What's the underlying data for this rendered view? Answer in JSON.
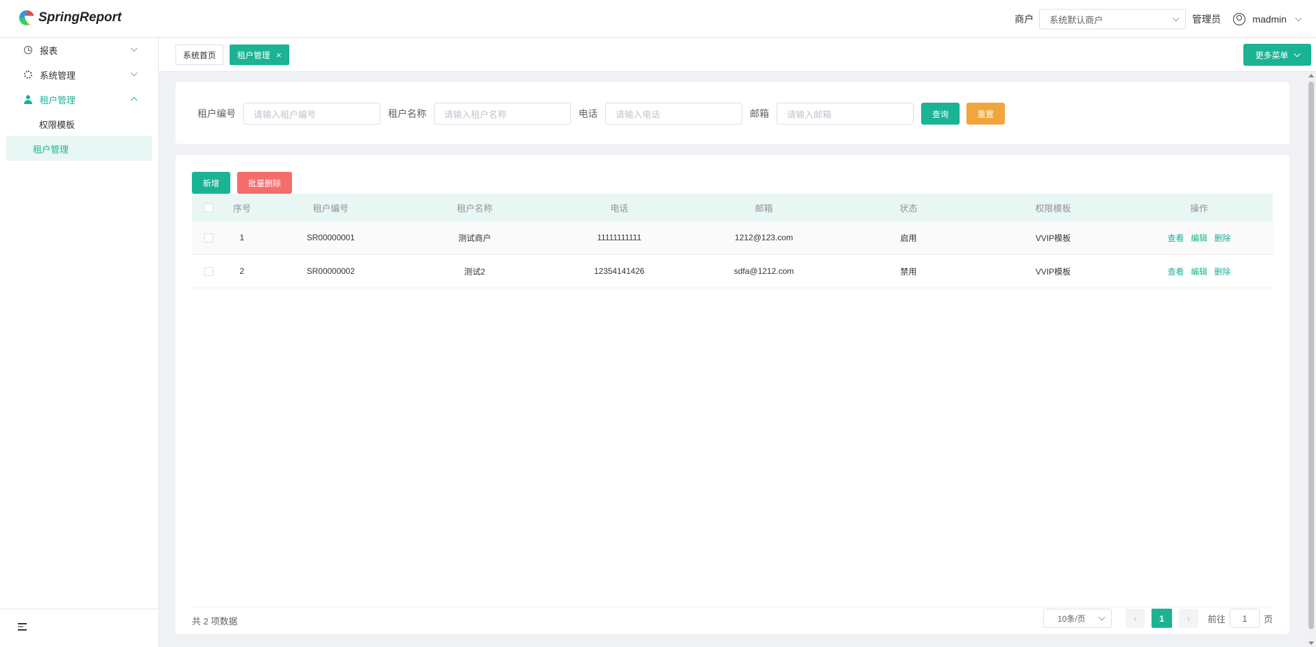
{
  "app": {
    "logo_text": "SpringReport"
  },
  "header": {
    "merchant_label": "商户",
    "merchant_value": "系统默认商户",
    "role_label": "管理员",
    "username": "madmin"
  },
  "sidebar": {
    "items": [
      {
        "label": "报表",
        "icon": "clock-icon"
      },
      {
        "label": "系统管理",
        "icon": "gear-icon"
      },
      {
        "label": "租户管理",
        "icon": "user-icon"
      }
    ],
    "subitems": [
      {
        "label": "权限模板"
      },
      {
        "label": "租户管理"
      }
    ]
  },
  "tabs": {
    "home": "系统首页",
    "active": "租户管理",
    "close": "×",
    "more_menu": "更多菜单"
  },
  "search": {
    "code_label": "租户编号",
    "code_placeholder": "请输入租户编号",
    "name_label": "租户名称",
    "name_placeholder": "请输入租户名称",
    "phone_label": "电话",
    "phone_placeholder": "请输入电话",
    "email_label": "邮箱",
    "email_placeholder": "请输入邮箱",
    "query_btn": "查询",
    "reset_btn": "重置"
  },
  "toolbar": {
    "add_btn": "新增",
    "batch_delete_btn": "批量删除"
  },
  "table": {
    "headers": [
      "序号",
      "租户编号",
      "租户名称",
      "电话",
      "邮箱",
      "状态",
      "权限模板",
      "操作"
    ],
    "rows": [
      {
        "idx": "1",
        "code": "SR00000001",
        "name": "测试商户",
        "phone": "11111111111",
        "email": "1212@123.com",
        "status": "启用",
        "template": "VVIP模板"
      },
      {
        "idx": "2",
        "code": "SR00000002",
        "name": "测试2",
        "phone": "12354141426",
        "email": "sdfa@1212.com",
        "status": "禁用",
        "template": "VVIP模板"
      }
    ],
    "actions": {
      "view": "查看",
      "edit": "编辑",
      "delete": "删除"
    }
  },
  "pagination": {
    "total_text": "共 2 项数据",
    "page_size": "10条/页",
    "current_page": "1",
    "prev": "‹",
    "next": "›",
    "goto_prefix": "前往",
    "goto_value": "1",
    "goto_suffix": "页"
  },
  "colors": {
    "primary": "#1ab394",
    "warning": "#f0a63a",
    "danger": "#f56c6c"
  }
}
